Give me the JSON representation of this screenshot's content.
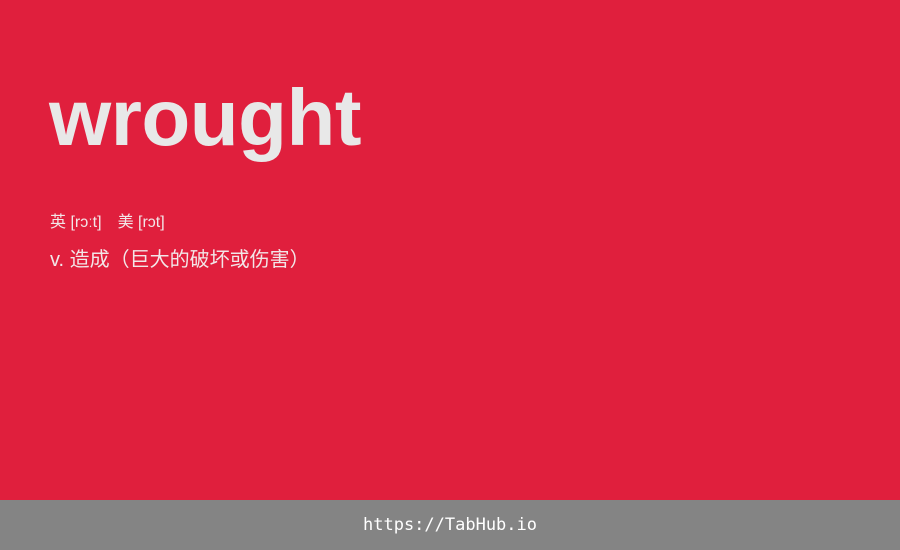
{
  "word": "wrought",
  "pronunciation": {
    "uk": "英 [rɔːt]",
    "us": "美 [rɔt]"
  },
  "definition": "v. 造成（巨大的破坏或伤害）",
  "footer": {
    "link": "https://TabHub.io"
  },
  "colors": {
    "background": "#e01f3d",
    "word": "#e8e8e8",
    "footer_bar": "#848484"
  }
}
